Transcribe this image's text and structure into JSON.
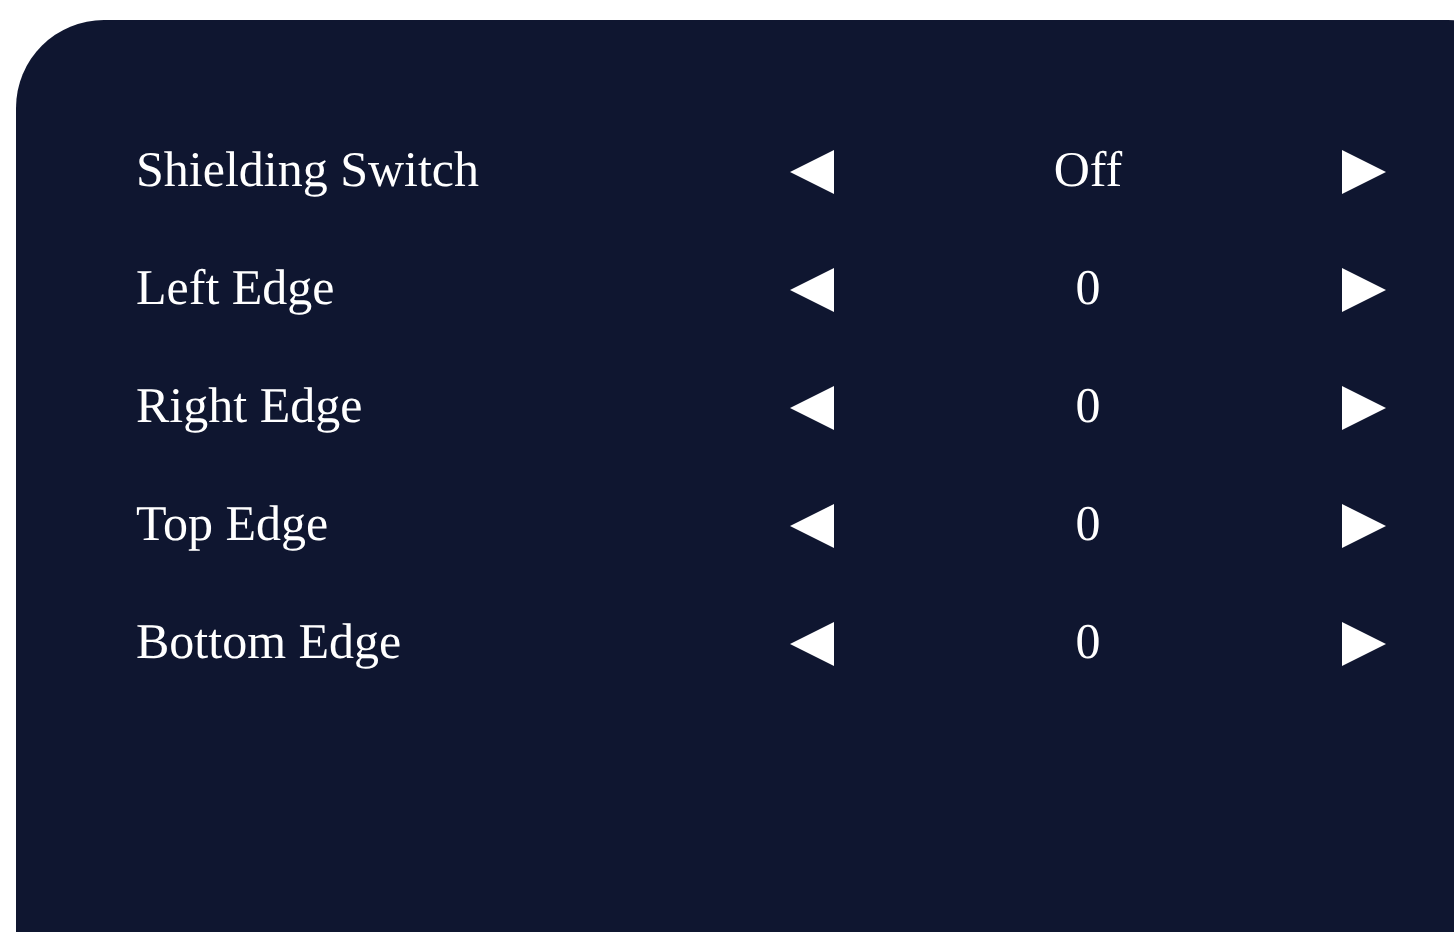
{
  "settings": [
    {
      "label": "Shielding Switch",
      "value": "Off"
    },
    {
      "label": "Left Edge",
      "value": "0"
    },
    {
      "label": "Right Edge",
      "value": "0"
    },
    {
      "label": "Top Edge",
      "value": "0"
    },
    {
      "label": "Bottom Edge",
      "value": "0"
    }
  ]
}
